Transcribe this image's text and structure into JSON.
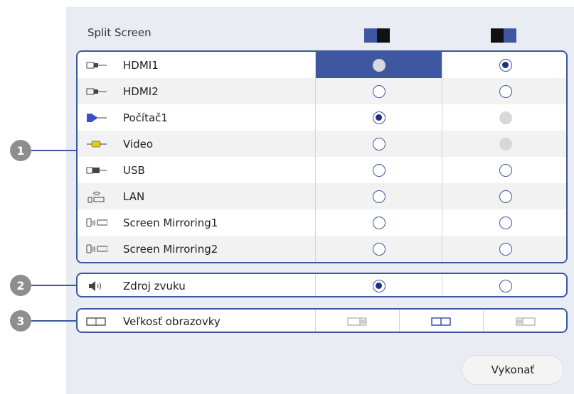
{
  "title": "Split Screen",
  "header_colors": {
    "accent": "#3f56a0",
    "dark": "#111111",
    "light": "#5b6fc4"
  },
  "sources": [
    {
      "label": "HDMI1",
      "icon": "hdmi-icon",
      "left": "selected-highlight",
      "right": "on"
    },
    {
      "label": "HDMI2",
      "icon": "hdmi-icon",
      "left": "off",
      "right": "off"
    },
    {
      "label": "Počítač1",
      "icon": "computer-icon",
      "left": "on",
      "right": "disabled"
    },
    {
      "label": "Video",
      "icon": "video-icon",
      "left": "off",
      "right": "disabled"
    },
    {
      "label": "USB",
      "icon": "usb-icon",
      "left": "off",
      "right": "off"
    },
    {
      "label": "LAN",
      "icon": "lan-icon",
      "left": "off",
      "right": "off"
    },
    {
      "label": "Screen Mirroring1",
      "icon": "screen-mirroring-icon",
      "left": "off",
      "right": "off"
    },
    {
      "label": "Screen Mirroring2",
      "icon": "screen-mirroring-icon",
      "left": "off",
      "right": "off"
    }
  ],
  "audio": {
    "label": "Zdroj zvuku",
    "icon": "speaker-icon",
    "left": "on",
    "right": "off"
  },
  "screen_size": {
    "label": "Veľkosť obrazovky",
    "icon": "screen-size-icon",
    "options": [
      "left-larger",
      "equal",
      "right-larger"
    ],
    "selected": "equal"
  },
  "badges": [
    "1",
    "2",
    "3"
  ],
  "execute_label": "Vykonať"
}
